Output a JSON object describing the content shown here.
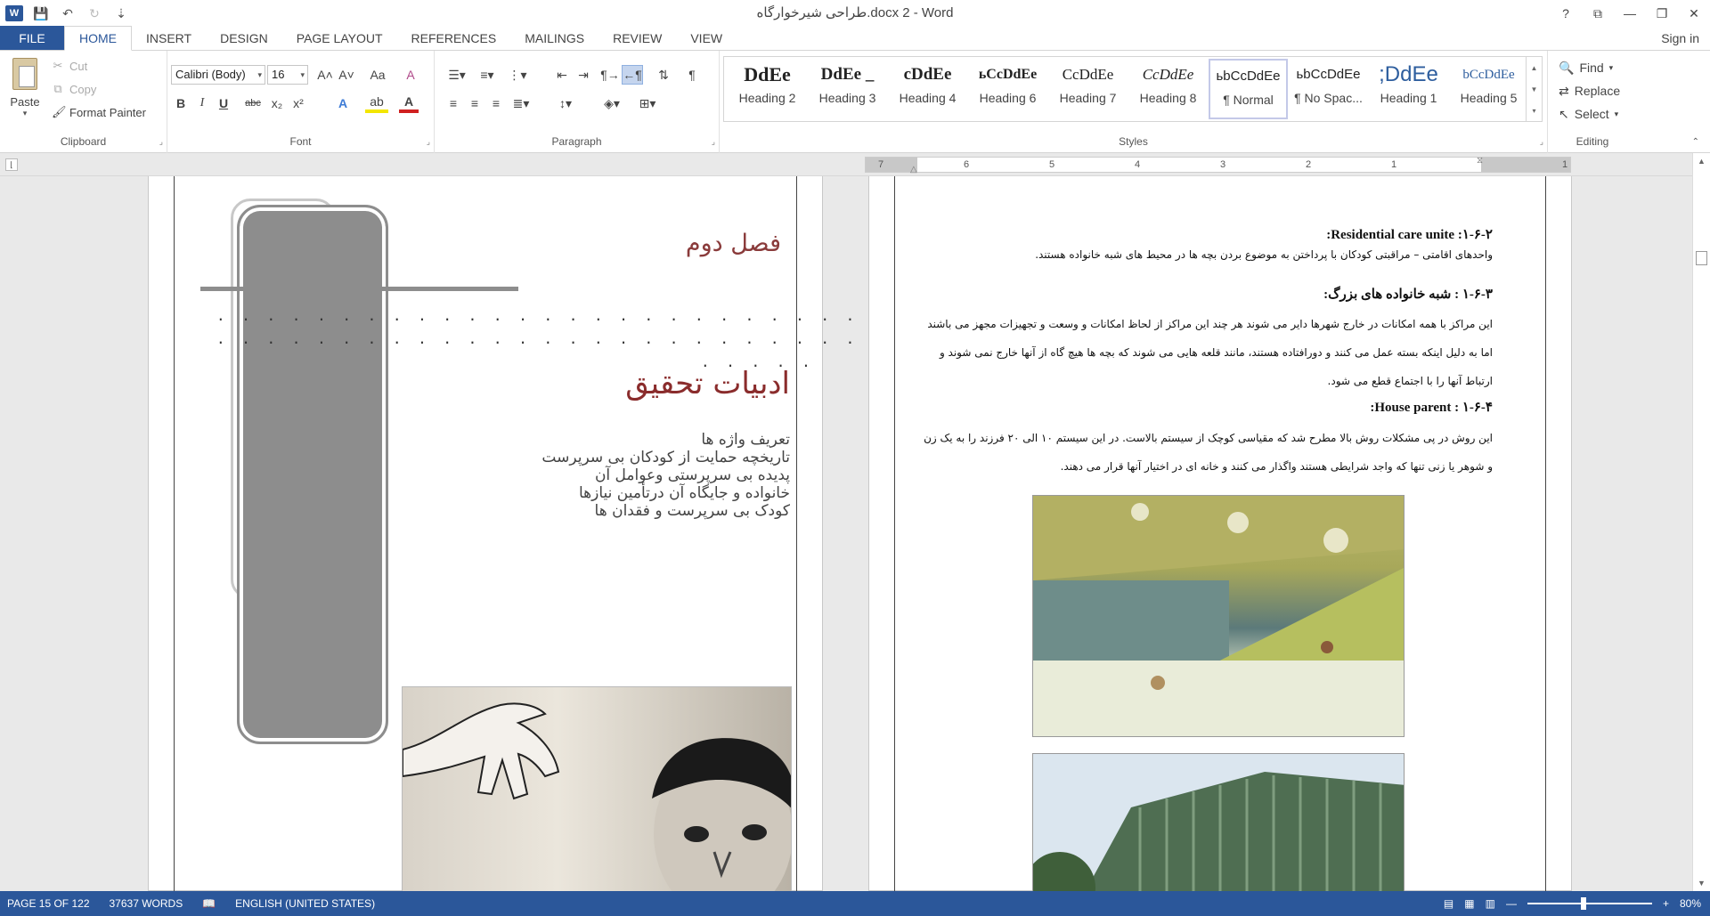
{
  "window": {
    "title": "طراحی شیرخوارگاه.docx 2 - Word",
    "controls": {
      "help": "?",
      "ribbon_opts": "⧉",
      "minimize": "—",
      "restore": "❐",
      "close": "✕"
    }
  },
  "qat": {
    "logo": "W",
    "save": "💾",
    "undo": "↶",
    "redo": "↻",
    "more": "⇣"
  },
  "tabs": {
    "file": "FILE",
    "items": [
      "HOME",
      "INSERT",
      "DESIGN",
      "PAGE LAYOUT",
      "REFERENCES",
      "MAILINGS",
      "REVIEW",
      "VIEW"
    ],
    "active": "HOME",
    "signin": "Sign in"
  },
  "clipboard": {
    "paste": "Paste",
    "cut": "Cut",
    "copy": "Copy",
    "format_painter": "Format Painter",
    "label": "Clipboard"
  },
  "font": {
    "name": "Calibri (Body)",
    "size": "16",
    "grow": "A˄",
    "shrink": "A˅",
    "case": "Aa",
    "clear": "A",
    "bold": "B",
    "italic": "I",
    "underline": "U",
    "strike": "abc",
    "sub": "x₂",
    "sup": "x²",
    "effects": "A",
    "highlight": "ab",
    "color": "A",
    "label": "Font"
  },
  "paragraph": {
    "label": "Paragraph",
    "pilcrow": "¶"
  },
  "styles": {
    "label": "Styles",
    "items": [
      {
        "preview": "DdEe",
        "name": "Heading 2"
      },
      {
        "preview": "DdEe _",
        "name": "Heading 3"
      },
      {
        "preview": "cDdEe",
        "name": "Heading 4"
      },
      {
        "preview": "ьCcDdEe",
        "name": "Heading 6"
      },
      {
        "preview": "CcDdEe",
        "name": "Heading 7"
      },
      {
        "preview": "CcDdEe",
        "name": "Heading 8"
      },
      {
        "preview": "ьbCcDdEe",
        "name": "¶ Normal"
      },
      {
        "preview": "ьbCcDdEe",
        "name": "¶ No Spac..."
      },
      {
        "preview": ";DdEe",
        "name": "Heading 1"
      },
      {
        "preview": "bCcDdEe",
        "name": "Heading 5"
      }
    ],
    "selected_index": 6
  },
  "editing": {
    "find": "Find",
    "replace": "Replace",
    "select": "Select",
    "label": "Editing"
  },
  "ruler": {
    "numbers": [
      "7",
      "6",
      "5",
      "4",
      "3",
      "2",
      "1",
      "1"
    ]
  },
  "left_page": {
    "chapter": "فصل دوم",
    "dots1": ". . . . . . . . . . . . . . . . . . . . . . . . . . . . . . . . . . . . . .",
    "dots2": ". . . . . . . . . . . . . . . . . . . . . . . . . . . . . . . . . . . . . .",
    "dots3": ". . . . .",
    "title": "ادبیات تحقیق",
    "toc": [
      "تعریف واژه ها",
      "تاریخچه حمایت از کودکان بی سرپرست",
      "پدیده بی سرپرستی وعوامل آن",
      "خانواده و جایگاه آن درتأمین نیازها",
      "کودک بی سرپرست و فقدان ها"
    ]
  },
  "right_page": {
    "h1": "۱-۶-۲: Residential care unite:",
    "p1": "واحدهای اقامتی – مراقبتی کودکان با پرداختن به موضوع بردن بچه ها در محیط های شبه خانواده هستند.",
    "h2": "۱-۶-۳ : شبه خانواده های بزرگ:",
    "p2": "این مراکز با همه امکانات در خارج شهرها دایر می شوند هر چند این مراکز از لحاظ امکانات و وسعت و تجهیزات مجهز می باشند اما به دلیل اینکه بسته عمل می کنند و دورافتاده هستند، مانند قلعه هایی می شوند که بچه ها هیچ گاه از آنها خارج نمی شوند و ارتباط آنها را با اجتماع قطع می شود.",
    "h3": "۱-۶-۴ : House parent:",
    "p3": "این روش در پی مشکلات روش بالا مطرح شد که مقیاسی کوچک از سیستم بالاست. در این سیستم ۱۰ الی ۲۰ فرزند را به یک زن و شوهر یا زنی تنها که واجد شرایطی هستند واگذار می کنند و خانه ای در اختیار آنها قرار می دهند."
  },
  "status": {
    "page": "PAGE 15 OF 122",
    "words": "37637 WORDS",
    "language": "ENGLISH (UNITED STATES)",
    "zoom": "80%"
  },
  "colors": {
    "accent": "#2b579a",
    "chapter_red": "#8a2c2c",
    "frame_gray": "#8d8d8d"
  }
}
